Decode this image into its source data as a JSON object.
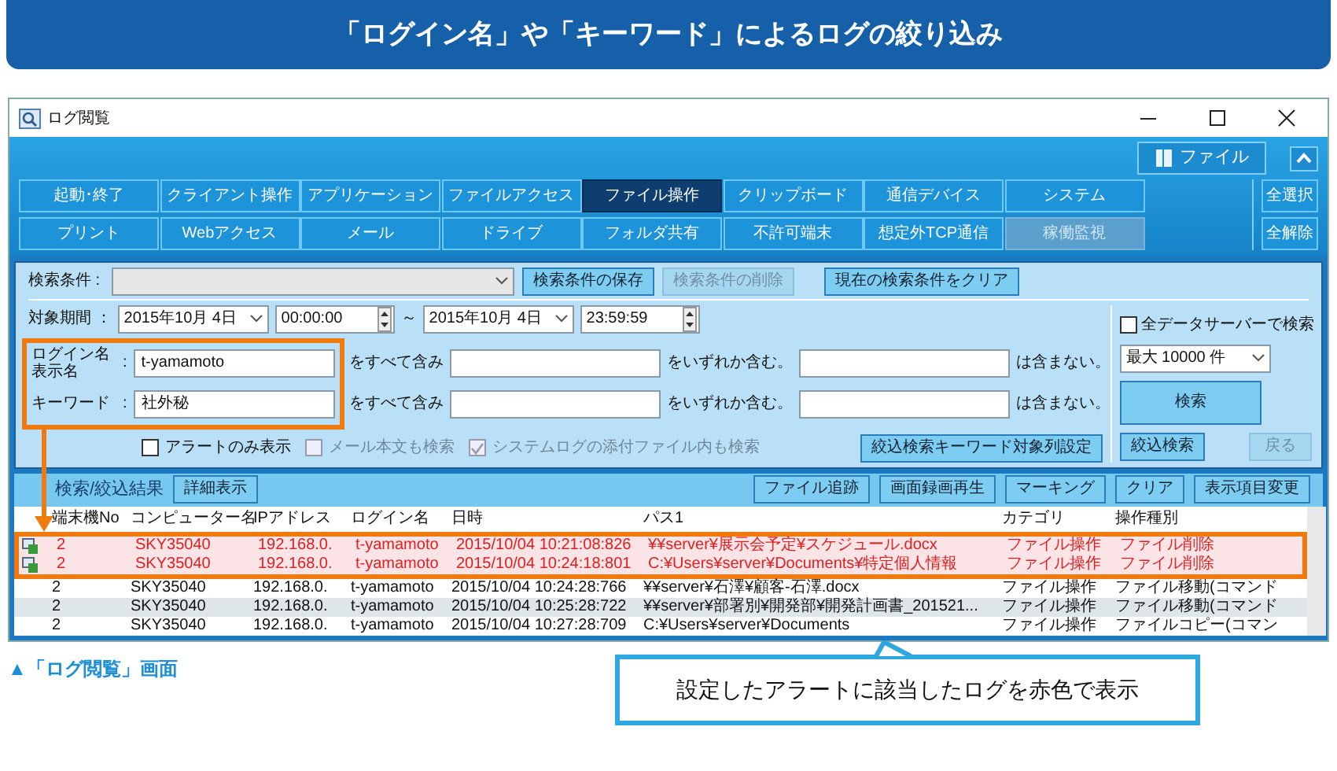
{
  "banner": {
    "title": "「ログイン名」や「キーワード」によるログの絞り込み"
  },
  "window": {
    "title": "ログ閲覧"
  },
  "ribbon": {
    "menu_button": "ファイル",
    "categories": [
      {
        "label": "起動･終了",
        "selected": false,
        "disabled": false
      },
      {
        "label": "クライアント操作",
        "selected": false,
        "disabled": false
      },
      {
        "label": "アプリケーション",
        "selected": false,
        "disabled": false
      },
      {
        "label": "ファイルアクセス",
        "selected": false,
        "disabled": false
      },
      {
        "label": "ファイル操作",
        "selected": true,
        "disabled": false
      },
      {
        "label": "クリップボード",
        "selected": false,
        "disabled": false
      },
      {
        "label": "通信デバイス",
        "selected": false,
        "disabled": false
      },
      {
        "label": "システム",
        "selected": false,
        "disabled": false
      },
      {
        "label": "プリント",
        "selected": false,
        "disabled": false
      },
      {
        "label": "Webアクセス",
        "selected": false,
        "disabled": false
      },
      {
        "label": "メール",
        "selected": false,
        "disabled": false
      },
      {
        "label": "ドライブ",
        "selected": false,
        "disabled": false
      },
      {
        "label": "フォルダ共有",
        "selected": false,
        "disabled": false
      },
      {
        "label": "不許可端末",
        "selected": false,
        "disabled": false
      },
      {
        "label": "想定外TCP通信",
        "selected": false,
        "disabled": false
      },
      {
        "label": "稼働監視",
        "selected": false,
        "disabled": true
      }
    ],
    "side_buttons": [
      "全選択",
      "全解除"
    ]
  },
  "search": {
    "condition_label": "検索条件 :",
    "condition_buttons": [
      {
        "label": "検索条件の保存",
        "disabled": false
      },
      {
        "label": "検索条件の削除",
        "disabled": true
      },
      {
        "label": "現在の検索条件をクリア",
        "disabled": false
      }
    ],
    "period_label": "対象期間 ：",
    "start_date": "2015年10月 4日",
    "start_time": "00:00:00",
    "tilde": "～",
    "end_date": "2015年10月 4日",
    "end_time": "23:59:59",
    "filters": [
      {
        "label": [
          "ログイン名",
          "表示名"
        ],
        "separator": ":",
        "value": "t-yamamoto",
        "all_text": "をすべて含み",
        "any_text": "をいずれか含む。",
        "none_text": "は含まない。"
      },
      {
        "label": [
          "キーワード"
        ],
        "separator": ":",
        "value": "社外秘",
        "all_text": "をすべて含み",
        "any_text": "をいずれか含む。",
        "none_text": "は含まない。"
      }
    ],
    "options": [
      {
        "label": "アラートのみ表示",
        "checked": false,
        "disabled": false
      },
      {
        "label": "メール本文も検索",
        "checked": false,
        "disabled": true
      },
      {
        "label": "システムログの添付ファイル内も検索",
        "checked": true,
        "disabled": true
      }
    ],
    "column_button": "絞込検索キーワード対象列設定",
    "all_servers": {
      "label": "全データサーバーで検索",
      "checked": false
    },
    "max_select": "最大 10000 件",
    "search_button": "検索",
    "refine_button": "絞込検索",
    "back_button": {
      "label": "戻る",
      "disabled": true
    }
  },
  "results": {
    "title": "検索/絞込結果",
    "detail_button": "詳細表示",
    "actions": [
      "ファイル追跡",
      "画面録画再生",
      "マーキング",
      "クリア",
      "表示項目変更"
    ],
    "columns": [
      "端末機No",
      "コンピューター名",
      "IPアドレス",
      "ログイン名",
      "日時",
      "パス1",
      "カテゴリ",
      "操作種別"
    ],
    "rows": [
      {
        "cells": [
          "2",
          "SKY35040",
          "192.168.0.",
          "t-yamamoto",
          "2015/10/04 10:21:08:826",
          "¥¥server¥展示会予定¥スケジュール.docx",
          "ファイル操作",
          "ファイル削除"
        ],
        "alert": true,
        "selected": false
      },
      {
        "cells": [
          "2",
          "SKY35040",
          "192.168.0.",
          "t-yamamoto",
          "2015/10/04 10:24:18:801",
          "C:¥Users¥server¥Documents¥特定個人情報",
          "ファイル操作",
          "ファイル削除"
        ],
        "alert": true,
        "selected": false
      },
      {
        "cells": [
          "2",
          "SKY35040",
          "192.168.0.",
          "t-yamamoto",
          "2015/10/04 10:24:28:766",
          "¥¥server¥石澤¥顧客-石澤.docx",
          "ファイル操作",
          "ファイル移動(コマンド"
        ],
        "alert": false,
        "selected": false
      },
      {
        "cells": [
          "2",
          "SKY35040",
          "192.168.0.",
          "t-yamamoto",
          "2015/10/04 10:25:28:722",
          "¥¥server¥部署別¥開発部¥開発計画書_201521...",
          "ファイル操作",
          "ファイル移動(コマンド"
        ],
        "alert": false,
        "selected": true
      },
      {
        "cells": [
          "2",
          "SKY35040",
          "192.168.0.",
          "t-yamamoto",
          "2015/10/04 10:27:28:709",
          "C:¥Users¥server¥Documents",
          "ファイル操作",
          "ファイルコピー(コマン"
        ],
        "alert": false,
        "selected": false
      }
    ]
  },
  "caption": "▲「ログ閲覧」画面",
  "callout": "設定したアラートに該当したログを赤色で表示"
}
